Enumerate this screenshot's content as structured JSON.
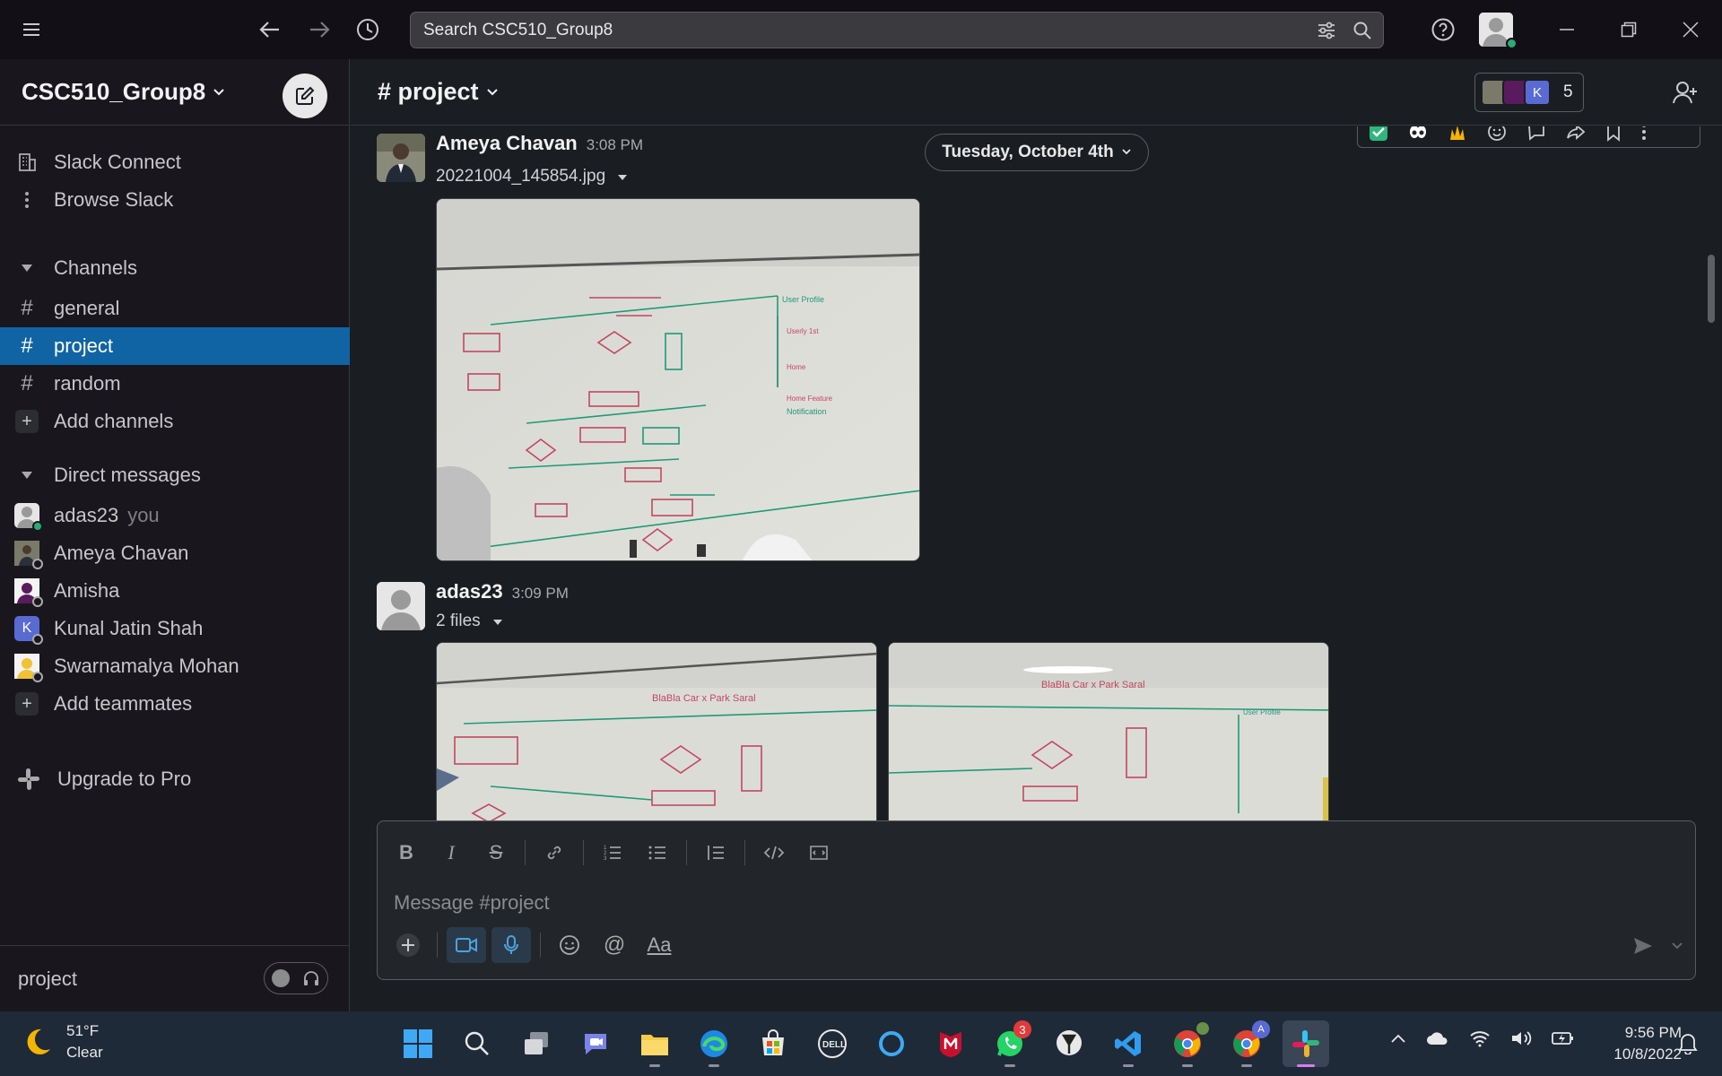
{
  "search": {
    "placeholder": "Search CSC510_Group8"
  },
  "workspace": {
    "name": "CSC510_Group8"
  },
  "sidebar": {
    "top_items": [
      {
        "label": "Slack Connect",
        "icon": "building-icon"
      },
      {
        "label": "Browse Slack",
        "icon": "more-vertical-icon"
      }
    ],
    "channels_header": "Channels",
    "channels": [
      {
        "label": "general",
        "active": false
      },
      {
        "label": "project",
        "active": true
      },
      {
        "label": "random",
        "active": false
      }
    ],
    "add_channels": "Add channels",
    "dm_header": "Direct messages",
    "dms": [
      {
        "label": "adas23",
        "suffix": "you"
      },
      {
        "label": "Ameya Chavan",
        "suffix": ""
      },
      {
        "label": "Amisha",
        "suffix": ""
      },
      {
        "label": "Kunal Jatin Shah",
        "suffix": ""
      },
      {
        "label": "Swarnamalya Mohan",
        "suffix": ""
      }
    ],
    "add_teammates": "Add teammates",
    "upgrade": "Upgrade to Pro",
    "footer_channel": "project"
  },
  "channel": {
    "title": "# project",
    "member_count": "5",
    "date_divider": "Tuesday, October 4th",
    "message_placeholder": "Message #project"
  },
  "messages": [
    {
      "author": "Ameya Chavan",
      "time": "3:08 PM",
      "file_label": "20221004_145854.jpg"
    },
    {
      "author": "adas23",
      "time": "3:09 PM",
      "file_label": "2 files"
    }
  ],
  "taskbar": {
    "temperature": "51°F",
    "condition": "Clear",
    "time": "9:56 PM",
    "date": "10/8/2022",
    "whatsapp_badge": "3",
    "member_initial": "K",
    "chrome_badge": "A"
  },
  "colors": {
    "active_channel": "#1164a3",
    "online": "#2bac76",
    "background": "#1a1d21",
    "sidebar": "#19171d"
  }
}
